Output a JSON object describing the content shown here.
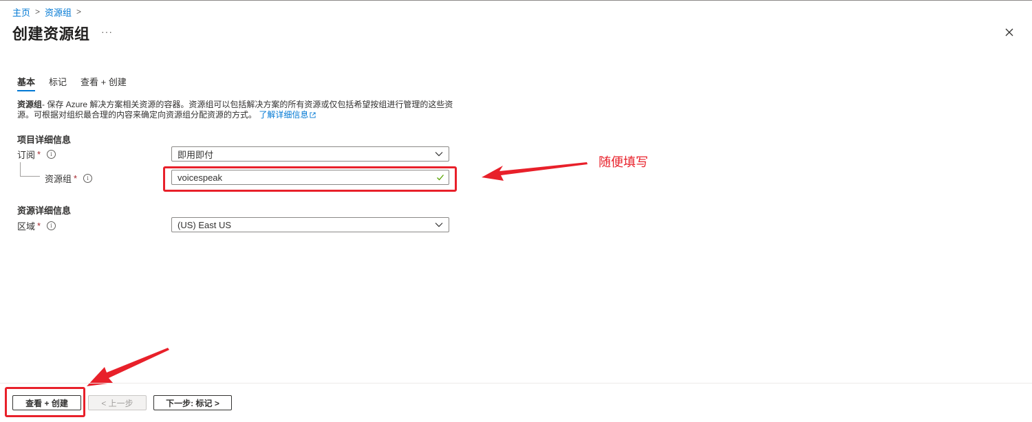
{
  "breadcrumb": [
    {
      "label": "主页"
    },
    {
      "label": "资源组"
    }
  ],
  "page": {
    "title": "创建资源组",
    "more": "···"
  },
  "tabs": [
    {
      "label": "基本",
      "active": true
    },
    {
      "label": "标记",
      "active": false
    },
    {
      "label": "查看 + 创建",
      "active": false
    }
  ],
  "description": {
    "bold": "资源组",
    "text_line1": "- 保存 Azure 解决方案相关资源的容器。资源组可以包括解决方案的所有资源或仅包括希望按组进行管理的这些资",
    "text_line2": "源。可根据对组织最合理的内容来确定向资源组分配资源的方式。",
    "link": "了解详细信息"
  },
  "project_details": {
    "title": "项目详细信息",
    "subscription": {
      "label": "订阅",
      "required": "*",
      "value": "即用即付"
    },
    "resource_group": {
      "label": "资源组",
      "required": "*",
      "value": "voicespeak"
    }
  },
  "resource_details": {
    "title": "资源详细信息",
    "region": {
      "label": "区域",
      "required": "*",
      "value": "(US) East US"
    }
  },
  "annotation": {
    "text": "随便填写",
    "color": "#e8202a"
  },
  "footer": {
    "review_create": "查看 + 创建",
    "previous": "< 上一步",
    "next": "下一步: 标记 >"
  },
  "colors": {
    "accent": "#0078d4",
    "required": "#a4262c",
    "valid": "#57a300"
  }
}
